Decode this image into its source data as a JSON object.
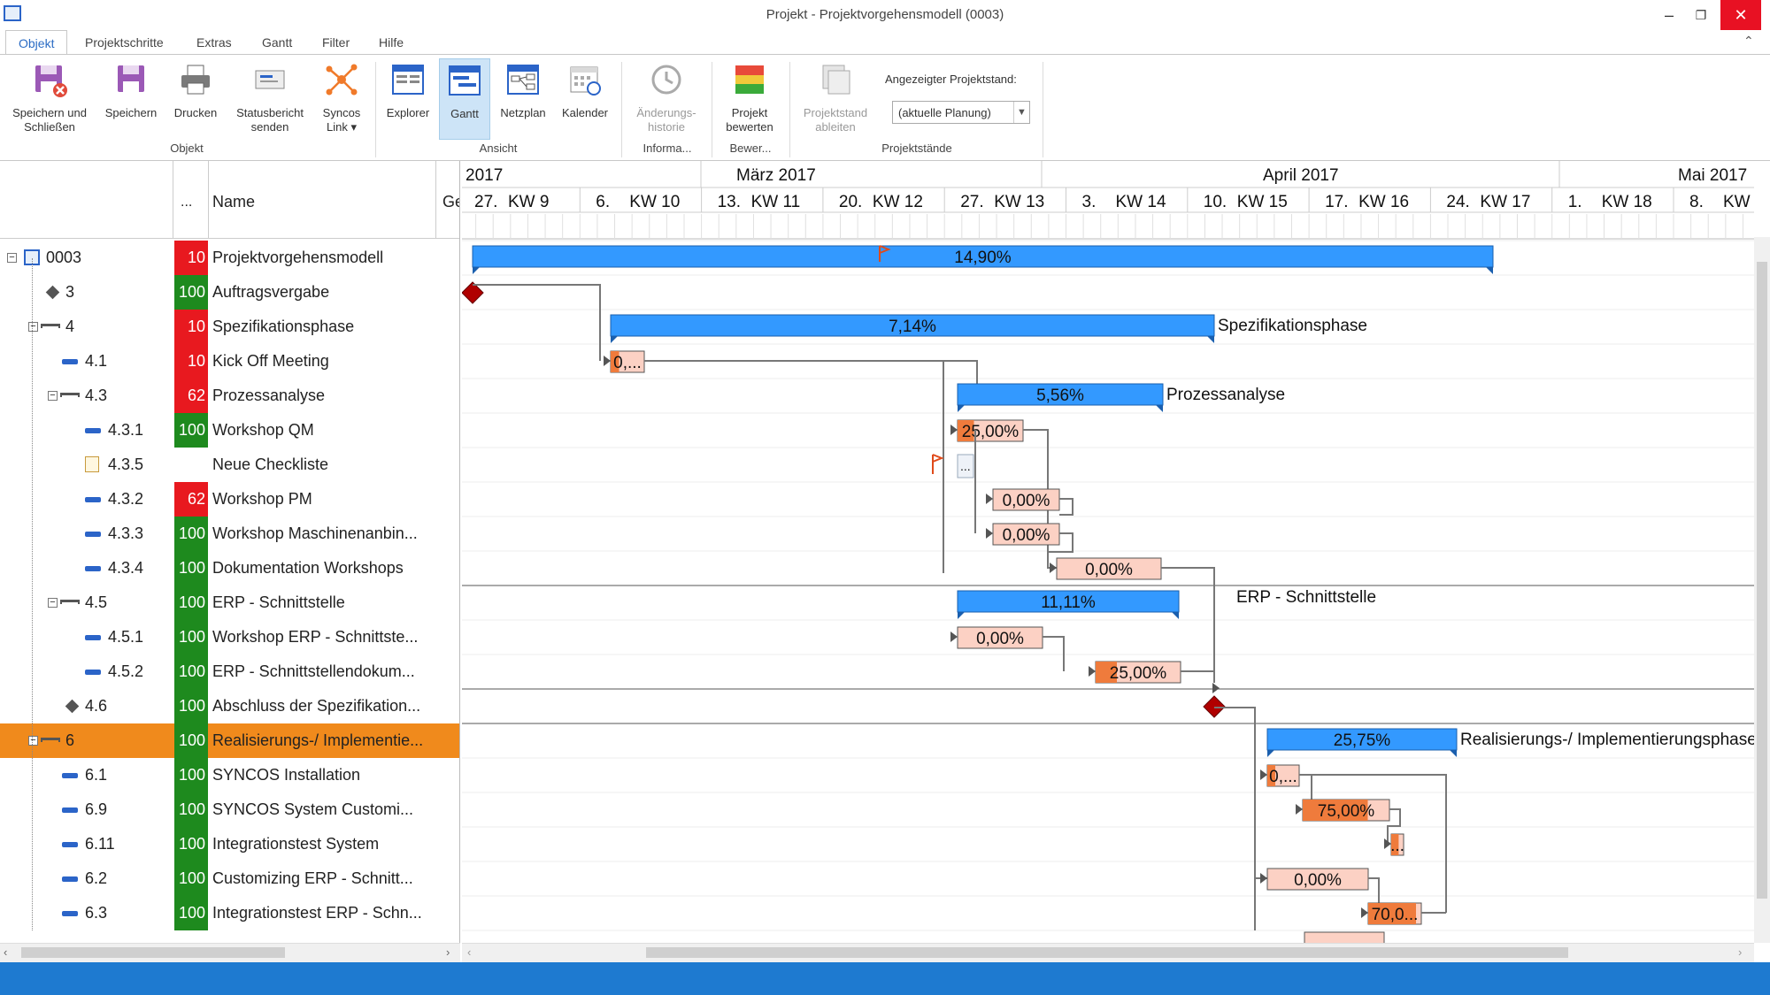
{
  "window": {
    "title": "Projekt - Projektvorgehensmodell (0003)"
  },
  "tabs": [
    "Objekt",
    "Projektschritte",
    "Extras",
    "Gantt",
    "Filter",
    "Hilfe"
  ],
  "ribbon": {
    "buttons": [
      {
        "label1": "Speichern und",
        "label2": "Schließen",
        "icon": "save-close-icon"
      },
      {
        "label1": "Speichern",
        "label2": "",
        "icon": "save-icon"
      },
      {
        "label1": "Drucken",
        "label2": "",
        "icon": "print-icon"
      },
      {
        "label1": "Statusbericht",
        "label2": "senden",
        "icon": "status-report-icon"
      },
      {
        "label1": "Syncos",
        "label2": "Link ▾",
        "icon": "syncos-link-icon"
      },
      {
        "label1": "Explorer",
        "label2": "",
        "icon": "explorer-icon"
      },
      {
        "label1": "Gantt",
        "label2": "",
        "icon": "gantt-icon"
      },
      {
        "label1": "Netzplan",
        "label2": "",
        "icon": "network-plan-icon"
      },
      {
        "label1": "Kalender",
        "label2": "",
        "icon": "calendar-icon"
      },
      {
        "label1": "Änderungs-",
        "label2": "historie",
        "icon": "history-icon"
      },
      {
        "label1": "Projekt",
        "label2": "bewerten",
        "icon": "evaluate-icon"
      },
      {
        "label1": "Projektstand",
        "label2": "ableiten",
        "icon": "derive-state-icon"
      }
    ],
    "groups": [
      "Objekt",
      "Ansicht",
      "Informa...",
      "Bewer...",
      "Projektstände"
    ],
    "projektstand_label": "Angezeigter Projektstand:",
    "projektstand_value": "(aktuelle Planung)"
  },
  "grid": {
    "col_dots": "...",
    "col_name": "Name",
    "col_ge": "Ge",
    "rows": [
      {
        "id": "0003",
        "pct": "10",
        "pct_color": "#e8191f",
        "name": "Projektvorgehensmodell",
        "kind": "project",
        "level": 0
      },
      {
        "id": "3",
        "pct": "100",
        "pct_color": "#1e8a1e",
        "name": "Auftragsvergabe",
        "kind": "milestone",
        "level": 1
      },
      {
        "id": "4",
        "pct": "10",
        "pct_color": "#e8191f",
        "name": "Spezifikationsphase",
        "kind": "summary",
        "level": 1
      },
      {
        "id": "4.1",
        "pct": "10",
        "pct_color": "#e8191f",
        "name": "Kick Off Meeting",
        "kind": "task",
        "level": 2
      },
      {
        "id": "4.3",
        "pct": "62",
        "pct_color": "#e8191f",
        "name": "Prozessanalyse",
        "kind": "summary",
        "level": 2
      },
      {
        "id": "4.3.1",
        "pct": "100",
        "pct_color": "#1e8a1e",
        "name": "Workshop QM",
        "kind": "task",
        "level": 3
      },
      {
        "id": "4.3.5",
        "pct": "",
        "pct_color": "",
        "name": "Neue Checkliste",
        "kind": "checklist",
        "level": 3
      },
      {
        "id": "4.3.2",
        "pct": "62",
        "pct_color": "#e8191f",
        "name": "Workshop PM",
        "kind": "task",
        "level": 3
      },
      {
        "id": "4.3.3",
        "pct": "100",
        "pct_color": "#1e8a1e",
        "name": "Workshop Maschinenanbin...",
        "kind": "task",
        "level": 3
      },
      {
        "id": "4.3.4",
        "pct": "100",
        "pct_color": "#1e8a1e",
        "name": "Dokumentation Workshops",
        "kind": "task",
        "level": 3
      },
      {
        "id": "4.5",
        "pct": "100",
        "pct_color": "#1e8a1e",
        "name": "ERP - Schnittstelle",
        "kind": "summary",
        "level": 2
      },
      {
        "id": "4.5.1",
        "pct": "100",
        "pct_color": "#1e8a1e",
        "name": "Workshop ERP - Schnittste...",
        "kind": "task",
        "level": 3
      },
      {
        "id": "4.5.2",
        "pct": "100",
        "pct_color": "#1e8a1e",
        "name": "ERP - Schnittstellendokum...",
        "kind": "task",
        "level": 3
      },
      {
        "id": "4.6",
        "pct": "100",
        "pct_color": "#1e8a1e",
        "name": "Abschluss der Spezifikation...",
        "kind": "milestone",
        "level": 2
      },
      {
        "id": "6",
        "pct": "100",
        "pct_color": "#1e8a1e",
        "name": "Realisierungs-/ Implementie...",
        "kind": "summary",
        "level": 1,
        "selected": true
      },
      {
        "id": "6.1",
        "pct": "100",
        "pct_color": "#1e8a1e",
        "name": "SYNCOS Installation",
        "kind": "task",
        "level": 2
      },
      {
        "id": "6.9",
        "pct": "100",
        "pct_color": "#1e8a1e",
        "name": "SYNCOS System Customi...",
        "kind": "task",
        "level": 2
      },
      {
        "id": "6.11",
        "pct": "100",
        "pct_color": "#1e8a1e",
        "name": "Integrationstest System",
        "kind": "task",
        "level": 2
      },
      {
        "id": "6.2",
        "pct": "100",
        "pct_color": "#1e8a1e",
        "name": "Customizing ERP - Schnitt...",
        "kind": "task",
        "level": 2
      },
      {
        "id": "6.3",
        "pct": "100",
        "pct_color": "#1e8a1e",
        "name": "Integrationstest ERP - Schn...",
        "kind": "task",
        "level": 2
      }
    ]
  },
  "timeline": {
    "months": [
      "2017",
      "März 2017",
      "April 2017",
      "Mai 2017"
    ],
    "weeks": [
      {
        "day": "27.",
        "kw": "KW 9"
      },
      {
        "day": "6.",
        "kw": "KW 10"
      },
      {
        "day": "13.",
        "kw": "KW 11"
      },
      {
        "day": "20.",
        "kw": "KW 12"
      },
      {
        "day": "27.",
        "kw": "KW 13"
      },
      {
        "day": "3.",
        "kw": "KW 14"
      },
      {
        "day": "10.",
        "kw": "KW 15"
      },
      {
        "day": "17.",
        "kw": "KW 16"
      },
      {
        "day": "24.",
        "kw": "KW 17"
      },
      {
        "day": "1.",
        "kw": "KW 18"
      },
      {
        "day": "8.",
        "kw": "KW"
      }
    ]
  },
  "gantt_labels": {
    "r0": "14,90%",
    "r2": "7,14%",
    "r2side": "Spezifikationsphase",
    "r3": "0,...",
    "r4": "5,56%",
    "r4side": "Prozessanalyse",
    "r5": "25,00%",
    "r6": "...",
    "r7": "0,00%",
    "r8": "0,00%",
    "r9": "0,00%",
    "r10": "11,11%",
    "r10side": "ERP - Schnittstelle",
    "r11": "0,00%",
    "r12": "25,00%",
    "r14": "25,75%",
    "r14side": "Realisierungs-/ Implementierungsphase",
    "r15": "0,...",
    "r16": "75,00%",
    "r17": "...",
    "r18": "0,00%",
    "r19": "70,0..."
  },
  "colors": {
    "summary_bar": "#3399ff",
    "task_bar": "#fcd1c4",
    "task_progress": "#ef7b3c",
    "milestone": "#b00000",
    "selected_row": "#f08a1c",
    "statusbar": "#1e7ad0"
  }
}
